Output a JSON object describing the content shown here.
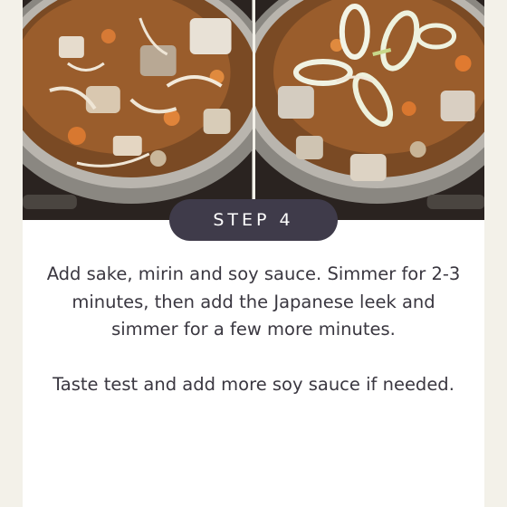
{
  "step": {
    "label": "STEP 4"
  },
  "photos": [
    {
      "icon": "stew-pot-photo-before-leek"
    },
    {
      "icon": "stew-pot-photo-with-leek"
    }
  ],
  "instructions": {
    "paragraph1": "Add sake, mirin and soy sauce. Simmer for 2-3 minutes, then add the Japanese leek and simmer for a few more minutes.",
    "paragraph2": "Taste test and add more soy sauce if needed."
  },
  "colors": {
    "background": "#f3f1e9",
    "card": "#ffffff",
    "pill": "#3f3b4a",
    "text": "#3a3740"
  }
}
